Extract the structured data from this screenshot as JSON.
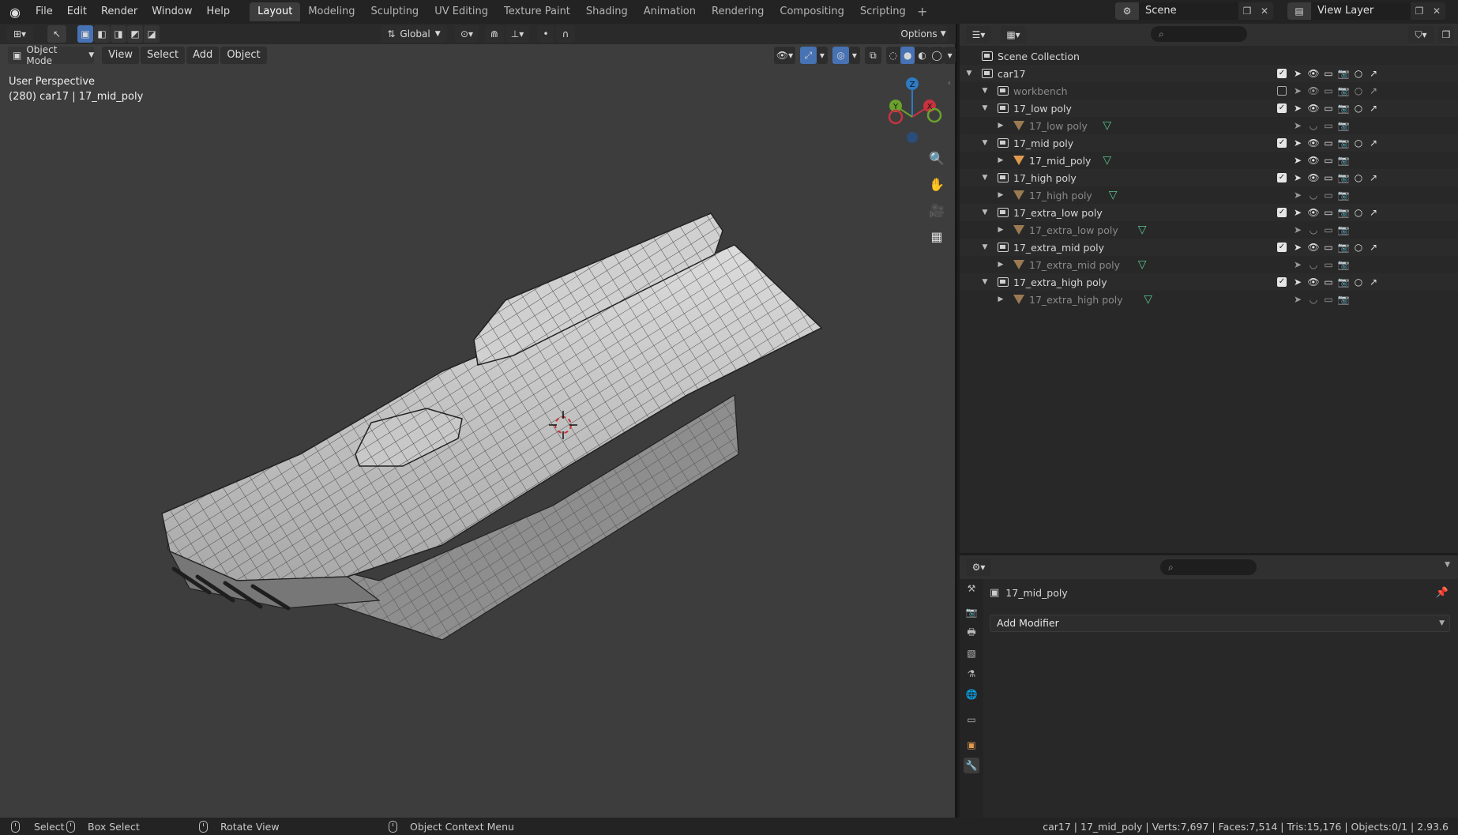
{
  "app": {
    "menu": [
      "File",
      "Edit",
      "Render",
      "Window",
      "Help"
    ],
    "workspaces": [
      "Layout",
      "Modeling",
      "Sculpting",
      "UV Editing",
      "Texture Paint",
      "Shading",
      "Animation",
      "Rendering",
      "Compositing",
      "Scripting"
    ],
    "active_workspace": "Layout",
    "scene": "Scene",
    "view_layer": "View Layer"
  },
  "viewport": {
    "transform_orientation": "Global",
    "options_label": "Options",
    "mode": "Object Mode",
    "menus": [
      "View",
      "Select",
      "Add",
      "Object"
    ],
    "perspective_label": "User Perspective",
    "object_info": "(280) car17 | 17_mid_poly",
    "gizmo_axes": {
      "x": "X",
      "y": "Y",
      "z": "Z"
    }
  },
  "outliner": {
    "scene_collection": "Scene Collection",
    "rows": [
      {
        "label": "car17",
        "type": "collection",
        "depth": 0,
        "dim": false,
        "checked": true
      },
      {
        "label": "workbench",
        "type": "collection",
        "depth": 1,
        "dim": true,
        "checked": false
      },
      {
        "label": "17_low poly",
        "type": "collection",
        "depth": 1,
        "dim": false,
        "checked": true
      },
      {
        "label": "17_low poly",
        "type": "object",
        "depth": 2,
        "dim": true
      },
      {
        "label": "17_mid poly",
        "type": "collection",
        "depth": 1,
        "dim": false,
        "checked": true
      },
      {
        "label": "17_mid_poly",
        "type": "object",
        "depth": 2,
        "dim": false
      },
      {
        "label": "17_high poly",
        "type": "collection",
        "depth": 1,
        "dim": false,
        "checked": true
      },
      {
        "label": "17_high poly",
        "type": "object",
        "depth": 2,
        "dim": true
      },
      {
        "label": "17_extra_low poly",
        "type": "collection",
        "depth": 1,
        "dim": false,
        "checked": true
      },
      {
        "label": "17_extra_low poly",
        "type": "object",
        "depth": 2,
        "dim": true
      },
      {
        "label": "17_extra_mid poly",
        "type": "collection",
        "depth": 1,
        "dim": false,
        "checked": true
      },
      {
        "label": "17_extra_mid poly",
        "type": "object",
        "depth": 2,
        "dim": true
      },
      {
        "label": "17_extra_high poly",
        "type": "collection",
        "depth": 1,
        "dim": false,
        "checked": true
      },
      {
        "label": "17_extra_high poly",
        "type": "object",
        "depth": 2,
        "dim": true
      }
    ]
  },
  "properties": {
    "object_name": "17_mid_poly",
    "add_modifier": "Add Modifier"
  },
  "status": {
    "select": "Select",
    "box_select": "Box Select",
    "rotate_view": "Rotate View",
    "context_menu": "Object Context Menu",
    "stats": "car17 | 17_mid_poly | Verts:7,697 | Faces:7,514 | Tris:15,176 | Objects:0/1 | 2.93.6"
  },
  "colors": {
    "accent": "#4772b3",
    "x_axis": "#c8323f",
    "y_axis": "#6aa12d",
    "z_axis": "#2d7bc4",
    "mesh_icon": "#e09a4f",
    "mesh_data": "#59c48f"
  }
}
